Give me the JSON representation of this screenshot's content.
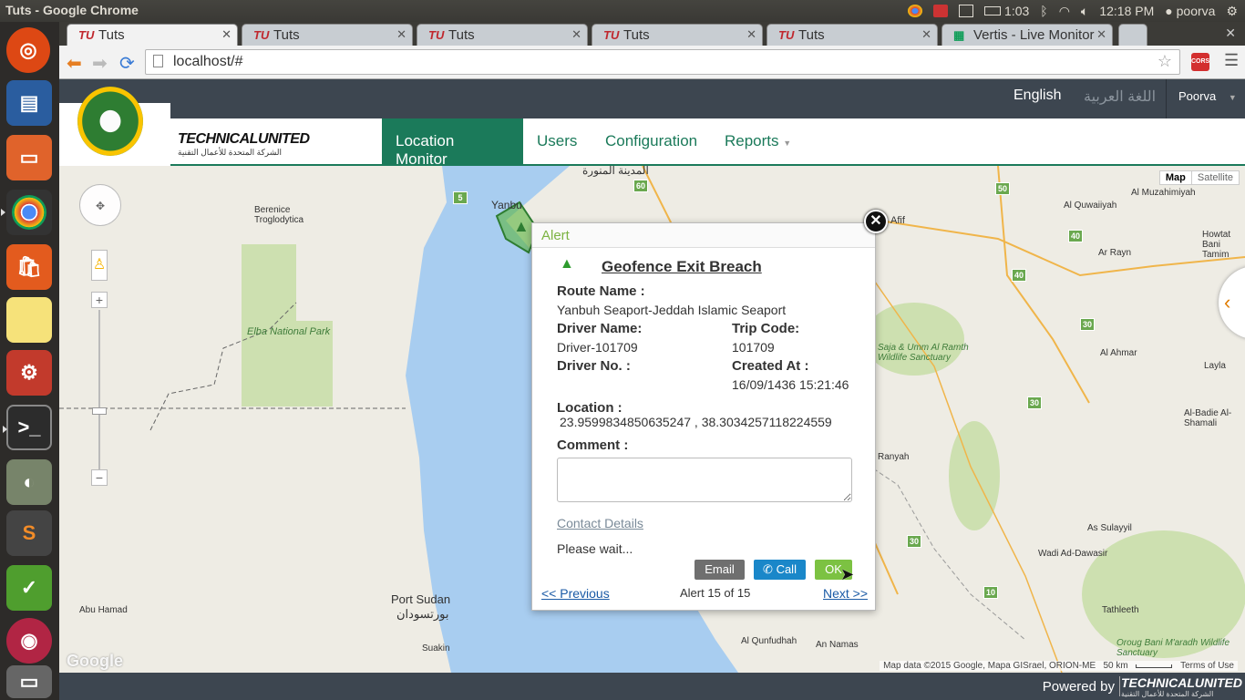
{
  "os": {
    "window_title": "Tuts - Google Chrome",
    "battery": "1:03",
    "clock": "12:18 PM",
    "user": "poorva"
  },
  "browser": {
    "tabs": [
      {
        "label": "Tuts",
        "active": true
      },
      {
        "label": "Tuts",
        "active": false
      },
      {
        "label": "Tuts",
        "active": false
      },
      {
        "label": "Tuts",
        "active": false
      },
      {
        "label": "Tuts",
        "active": false
      },
      {
        "label": "Vertis - Live Monitor",
        "active": false
      }
    ],
    "url": "localhost/#",
    "ext_badge": "CORS"
  },
  "app": {
    "lang_en": "English",
    "lang_ar": "اللغة العربية",
    "user_menu": "Poorva",
    "brand": "TECHNICALUNITED",
    "brand_ar": "الشركة المتحدة للأعمال التقنية",
    "nav": [
      {
        "label": "Location Monitor",
        "active": true
      },
      {
        "label": "Users",
        "active": false
      },
      {
        "label": "Configuration",
        "active": false
      },
      {
        "label": "Reports",
        "active": false
      }
    ],
    "footer_powered": "Powered by"
  },
  "map": {
    "type_map": "Map",
    "type_satellite": "Satellite",
    "google": "Google",
    "attribution": "Map data ©2015 Google, Mapa GISrael, ORION-ME",
    "scale": "50 km",
    "terms": "Terms of Use",
    "labels": [
      {
        "text": "Yanbu"
      },
      {
        "text": "المدينة المنورة"
      },
      {
        "text": "Berenice Troglodytica"
      },
      {
        "text": "Elba National Park"
      },
      {
        "text": "Port Sudan"
      },
      {
        "text": "بورتسودان"
      },
      {
        "text": "Suakin"
      },
      {
        "text": "Abu Hamad"
      },
      {
        "text": "Afif"
      },
      {
        "text": "Al Quwaiiyah"
      },
      {
        "text": "Al Muzahimiyah"
      },
      {
        "text": "Ar Rayn"
      },
      {
        "text": "Saja & Umm Al Ramth Wildlife Sanctuary"
      },
      {
        "text": "Al Ahmar"
      },
      {
        "text": "Layla"
      },
      {
        "text": "Ranyah"
      },
      {
        "text": "Al-Badie Al-Shamali"
      },
      {
        "text": "As Sulayyil"
      },
      {
        "text": "Wadi Ad-Dawasir"
      },
      {
        "text": "Tathleeth"
      },
      {
        "text": "Al Qunfudhah"
      },
      {
        "text": "An Namas"
      },
      {
        "text": "Oroug Bani M'aradh Wildlife Sanctuary"
      },
      {
        "text": "Howtat Bani Tamim"
      }
    ]
  },
  "alert": {
    "header": "Alert",
    "title": "Geofence Exit Breach",
    "route_label": "Route Name :",
    "route_value": "Yanbuh Seaport-Jeddah Islamic Seaport",
    "driver_name_label": "Driver Name:",
    "driver_name_value": "Driver-101709",
    "trip_code_label": "Trip Code:",
    "trip_code_value": "101709",
    "driver_no_label": "Driver No. :",
    "created_label": "Created At :",
    "created_value": "16/09/1436 15:21:46",
    "location_label": "Location :",
    "location_value": "23.9599834850635247 , 38.3034257118224559",
    "comment_label": "Comment :",
    "comment_value": "",
    "contact_link": "Contact Details",
    "status": "Please wait...",
    "email_btn": "Email",
    "call_btn": "Call",
    "ok_btn": "OK",
    "prev": "<< Previous",
    "counter": "Alert 15 of 15",
    "next": "Next >>"
  }
}
